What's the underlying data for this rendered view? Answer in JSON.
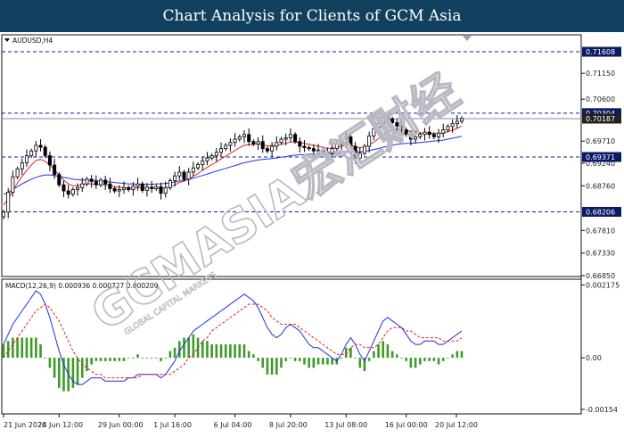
{
  "banner": {
    "title": "Chart Analysis for Clients of GCM Asia"
  },
  "watermark": {
    "brand": "GCMASIA宏汇财经",
    "tagline": "GLOBAL CAPITAL MARKETS"
  },
  "colors": {
    "banner_bg": "#12415f",
    "ma_fast": "#e0242a",
    "ma_slow": "#2433e0",
    "macd_line": "#1d2fe0",
    "macd_signal": "#e02020",
    "macd_hist": "#3f9a2a",
    "level_line": "#1a1aa0",
    "price_line": "#7d8ea0",
    "badge_bg": "#0b1a66",
    "candle": "#000000"
  },
  "chart_data": [
    {
      "type": "candlestick",
      "symbol_label": "AUDUSD,H4",
      "x_tick_labels": [
        "21 Jun 2020",
        "24 Jun 12:00",
        "29 Jun 00:00",
        "1 Jul 16:00",
        "6 Jul 04:00",
        "8 Jul 20:00",
        "13 Jul 08:00",
        "16 Jul 00:00",
        "20 Jul 12:00"
      ],
      "y_tick_labels": [
        "0.71150",
        "0.70600",
        "0.69710",
        "0.69240",
        "0.68760",
        "0.67810",
        "0.67330",
        "0.66850"
      ],
      "ylim": [
        0.6685,
        0.7195
      ],
      "levels": [
        0.71608,
        0.70304,
        0.69371,
        0.68206
      ],
      "level_labels": [
        "0.71608",
        "0.70304",
        "0.69371",
        "0.68206"
      ],
      "current_price": 0.70187,
      "current_price_label": "0.70187",
      "close": [
        0.682,
        0.6862,
        0.6895,
        0.6912,
        0.6925,
        0.694,
        0.695,
        0.6962,
        0.6958,
        0.694,
        0.692,
        0.69,
        0.6878,
        0.6865,
        0.6858,
        0.6868,
        0.6872,
        0.688,
        0.689,
        0.6885,
        0.6878,
        0.6888,
        0.688,
        0.687,
        0.6865,
        0.6868,
        0.6872,
        0.6868,
        0.6875,
        0.688,
        0.6866,
        0.6873,
        0.687,
        0.6874,
        0.686,
        0.6872,
        0.6887,
        0.6897,
        0.6905,
        0.689,
        0.6905,
        0.6914,
        0.6921,
        0.6929,
        0.6935,
        0.694,
        0.6947,
        0.6955,
        0.6962,
        0.6968,
        0.6975,
        0.698,
        0.6985,
        0.697,
        0.6965,
        0.697,
        0.6955,
        0.695,
        0.696,
        0.6968,
        0.6975,
        0.6978,
        0.6985,
        0.697,
        0.696,
        0.6957,
        0.6955,
        0.695,
        0.6952,
        0.6948,
        0.6945,
        0.6955,
        0.6965,
        0.6975,
        0.698,
        0.696,
        0.6935,
        0.6945,
        0.696,
        0.6982,
        0.6997,
        0.7008,
        0.7022,
        0.7018,
        0.701,
        0.7003,
        0.6995,
        0.6985,
        0.6975,
        0.698,
        0.6985,
        0.699,
        0.6985,
        0.698,
        0.6988,
        0.6995,
        0.7002,
        0.7008,
        0.7013,
        0.7019
      ],
      "ma_fast": [
        0.6835,
        0.6848,
        0.6866,
        0.6882,
        0.6896,
        0.6909,
        0.692,
        0.693,
        0.6932,
        0.6928,
        0.692,
        0.691,
        0.6898,
        0.6888,
        0.688,
        0.6876,
        0.6876,
        0.6878,
        0.688,
        0.688,
        0.6879,
        0.6879,
        0.6878,
        0.6876,
        0.6874,
        0.6873,
        0.6872,
        0.6871,
        0.6871,
        0.6872,
        0.6871,
        0.6871,
        0.6871,
        0.6871,
        0.687,
        0.6871,
        0.6874,
        0.6878,
        0.6883,
        0.6886,
        0.689,
        0.6896,
        0.6902,
        0.6909,
        0.6915,
        0.6921,
        0.6927,
        0.6933,
        0.6939,
        0.6945,
        0.6951,
        0.6957,
        0.6962,
        0.6963,
        0.6964,
        0.6965,
        0.6963,
        0.6961,
        0.6961,
        0.6962,
        0.6964,
        0.6966,
        0.6969,
        0.6969,
        0.6968,
        0.6966,
        0.6964,
        0.6962,
        0.696,
        0.6958,
        0.6956,
        0.6956,
        0.6957,
        0.696,
        0.6963,
        0.6963,
        0.6958,
        0.6957,
        0.6958,
        0.6963,
        0.6969,
        0.6976,
        0.6984,
        0.699,
        0.6994,
        0.6996,
        0.6996,
        0.6994,
        0.6991,
        0.6989,
        0.6988,
        0.6988,
        0.6988,
        0.6987,
        0.6987,
        0.6988,
        0.6991,
        0.6994,
        0.6998,
        0.7003
      ],
      "ma_slow": [
        0.6858,
        0.6862,
        0.6868,
        0.6874,
        0.688,
        0.6885,
        0.689,
        0.6894,
        0.6897,
        0.6899,
        0.6899,
        0.6898,
        0.6896,
        0.6894,
        0.6892,
        0.689,
        0.6889,
        0.6888,
        0.6888,
        0.6888,
        0.6887,
        0.6886,
        0.6885,
        0.6884,
        0.6883,
        0.6882,
        0.6881,
        0.688,
        0.688,
        0.6879,
        0.6879,
        0.6879,
        0.6879,
        0.688,
        0.688,
        0.6881,
        0.6882,
        0.6884,
        0.6886,
        0.6888,
        0.689,
        0.6892,
        0.6895,
        0.6898,
        0.6901,
        0.6904,
        0.6907,
        0.691,
        0.6913,
        0.6916,
        0.6919,
        0.6922,
        0.6925,
        0.6927,
        0.6929,
        0.6931,
        0.6932,
        0.6933,
        0.6934,
        0.6935,
        0.6937,
        0.6938,
        0.694,
        0.6941,
        0.6942,
        0.6942,
        0.6943,
        0.6943,
        0.6943,
        0.6943,
        0.6943,
        0.6944,
        0.6945,
        0.6946,
        0.6948,
        0.6948,
        0.6948,
        0.6948,
        0.6949,
        0.6951,
        0.6953,
        0.6955,
        0.6958,
        0.696,
        0.6962,
        0.6964,
        0.6965,
        0.6966,
        0.6966,
        0.6967,
        0.6968,
        0.6969,
        0.697,
        0.6971,
        0.6972,
        0.6973,
        0.6975,
        0.6977,
        0.6979,
        0.6981
      ]
    },
    {
      "type": "macd",
      "label": "MACD(12,26,9) 0.000936 0.000727 0.000209",
      "y_tick_labels": [
        "0.002175",
        "0.00",
        "-0.00154"
      ],
      "ylim": [
        -0.00165,
        0.00232
      ],
      "macd": [
        0.0004,
        0.0007,
        0.001,
        0.0012,
        0.0014,
        0.0016,
        0.0018,
        0.002,
        0.0019,
        0.0016,
        0.0012,
        0.0007,
        0.0002,
        -0.0002,
        -0.0005,
        -0.0007,
        -0.0008,
        -0.0008,
        -0.0007,
        -0.0006,
        -0.0006,
        -0.0006,
        -0.0007,
        -0.0007,
        -0.0007,
        -0.0007,
        -0.0007,
        -0.0006,
        -0.0006,
        -0.0005,
        -0.0005,
        -0.0005,
        -0.0005,
        -0.0005,
        -0.0006,
        -0.0005,
        -0.0003,
        -0.0001,
        0.0002,
        0.0004,
        0.0006,
        0.0008,
        0.0009,
        0.001,
        0.0011,
        0.0012,
        0.0013,
        0.0014,
        0.0015,
        0.0016,
        0.0017,
        0.0018,
        0.0019,
        0.0018,
        0.0017,
        0.0015,
        0.0012,
        0.0009,
        0.0007,
        0.0006,
        0.0007,
        0.0009,
        0.001,
        0.0009,
        0.0008,
        0.0006,
        0.0004,
        0.0003,
        0.0003,
        0.0002,
        0.0001,
        0.0,
        -0.0001,
        0.0001,
        0.0004,
        0.0006,
        0.0004,
        0.0001,
        -0.0001,
        0.0002,
        0.0005,
        0.0008,
        0.0011,
        0.0012,
        0.0011,
        0.001,
        0.0009,
        0.0007,
        0.0005,
        0.0004,
        0.0004,
        0.0005,
        0.0005,
        0.0005,
        0.0004,
        0.0004,
        0.0005,
        0.0006,
        0.0007,
        0.0008
      ],
      "signal": [
        0.0,
        0.0002,
        0.0004,
        0.0006,
        0.0008,
        0.001,
        0.0012,
        0.0014,
        0.0015,
        0.0016,
        0.0015,
        0.0013,
        0.0011,
        0.0008,
        0.0005,
        0.0002,
        0.0,
        -0.0002,
        -0.0003,
        -0.0004,
        -0.0005,
        -0.0005,
        -0.0006,
        -0.0006,
        -0.0006,
        -0.0006,
        -0.0006,
        -0.0006,
        -0.0006,
        -0.0006,
        -0.0005,
        -0.0005,
        -0.0005,
        -0.0005,
        -0.0005,
        -0.0005,
        -0.0005,
        -0.0004,
        -0.0003,
        -0.0002,
        0.0,
        0.0001,
        0.0003,
        0.0005,
        0.0006,
        0.0008,
        0.0009,
        0.001,
        0.0011,
        0.0012,
        0.0013,
        0.0014,
        0.0015,
        0.0016,
        0.0016,
        0.0016,
        0.0015,
        0.0014,
        0.0012,
        0.0011,
        0.001,
        0.001,
        0.001,
        0.001,
        0.0009,
        0.0008,
        0.0007,
        0.0006,
        0.0005,
        0.0004,
        0.0003,
        0.0002,
        0.0001,
        0.0001,
        0.0001,
        0.0003,
        0.0004,
        0.0004,
        0.0003,
        0.0003,
        0.0003,
        0.0004,
        0.0006,
        0.0008,
        0.0009,
        0.0009,
        0.0009,
        0.0008,
        0.0008,
        0.0007,
        0.0006,
        0.0006,
        0.0006,
        0.0006,
        0.0006,
        0.0005,
        0.0005,
        0.0005,
        0.0005,
        0.0006
      ]
    }
  ]
}
